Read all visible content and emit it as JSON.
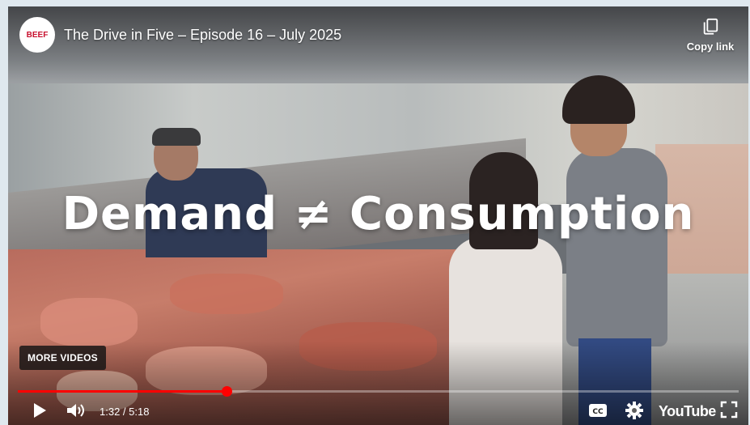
{
  "player": {
    "title": "The Drive in Five – Episode 16 – July 2025",
    "channel_logo_text": "BEEF",
    "copy_link_label": "Copy link",
    "overlay_caption": "Demand ≠ Consumption",
    "more_videos_label": "MORE VIDEOS",
    "time_display": "1:32 / 5:18",
    "progress_fraction": 0.29,
    "youtube_label": "YouTube"
  },
  "colors": {
    "progress": "#ff0000",
    "page_background": "#dfe8ee",
    "logo_red": "#c8102e"
  },
  "icons": [
    "copy-icon",
    "play-icon",
    "volume-icon",
    "captions-icon",
    "settings-icon",
    "fullscreen-icon"
  ]
}
